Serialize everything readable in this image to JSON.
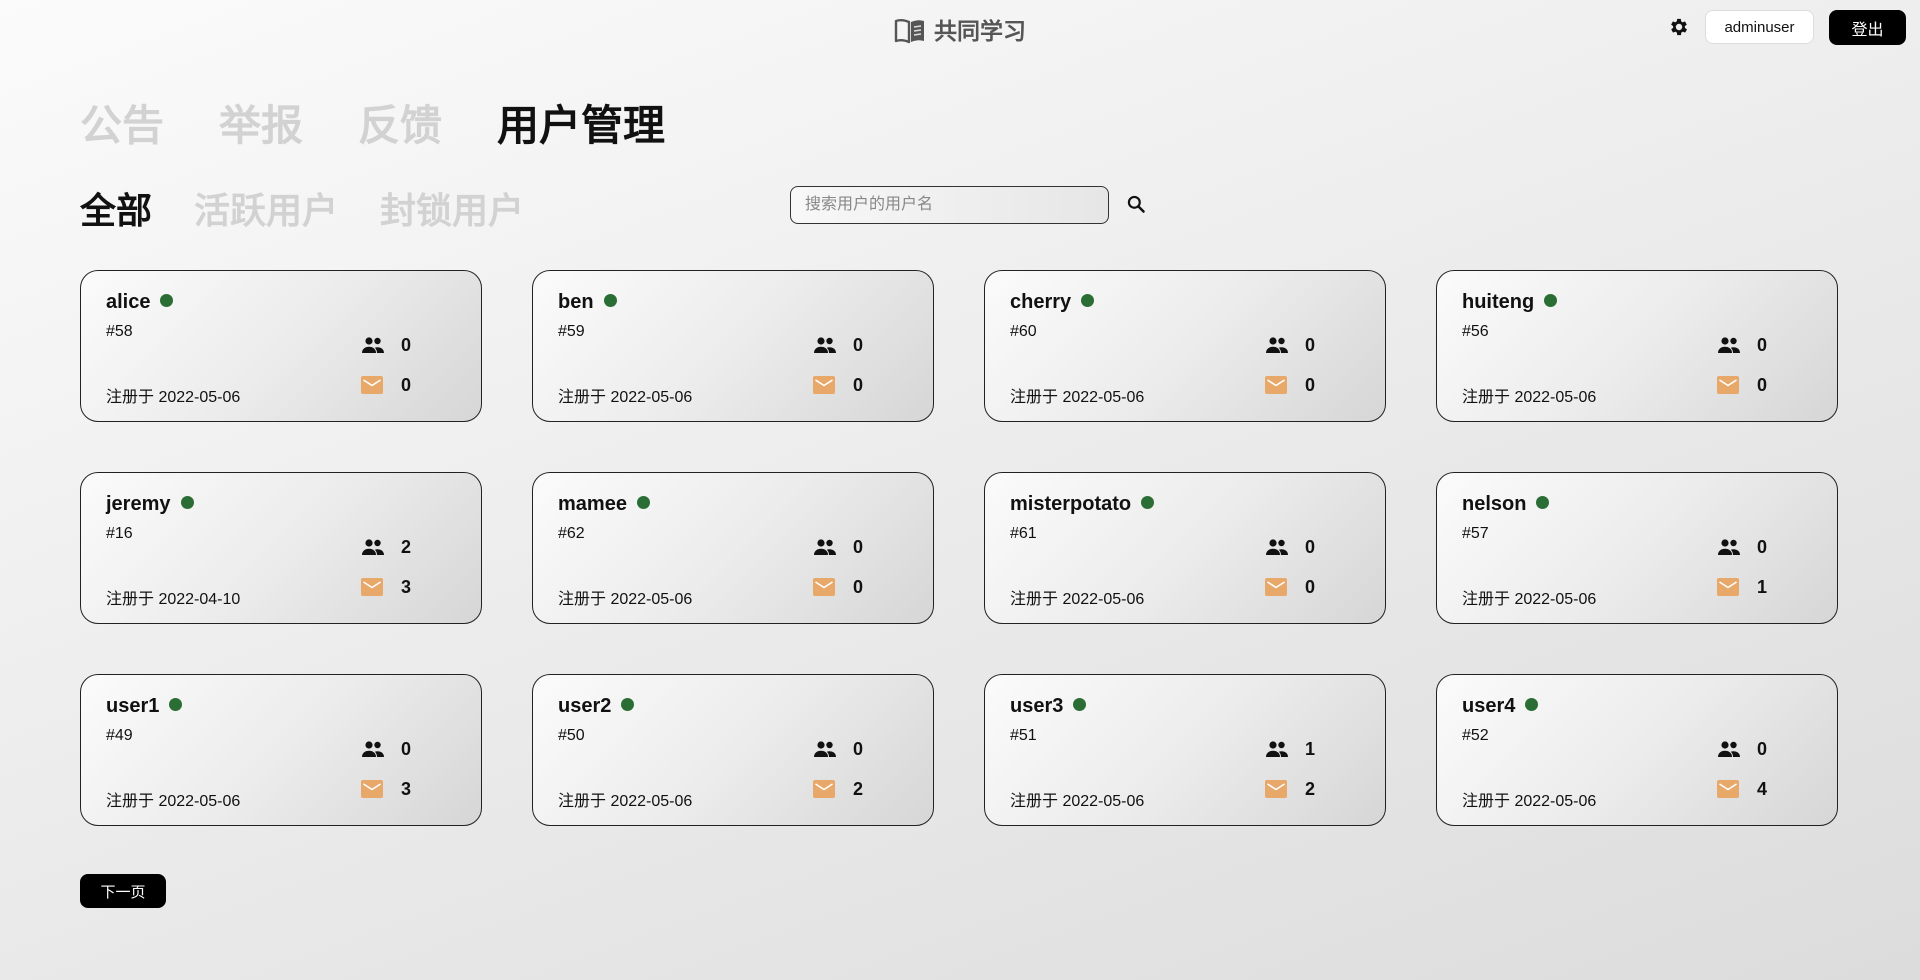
{
  "header": {
    "brand": "共同学习",
    "username": "adminuser",
    "logout_label": "登出"
  },
  "main_tabs": [
    {
      "label": "公告",
      "active": false
    },
    {
      "label": "举报",
      "active": false
    },
    {
      "label": "反馈",
      "active": false
    },
    {
      "label": "用户管理",
      "active": true
    }
  ],
  "sub_tabs": [
    {
      "label": "全部",
      "active": true
    },
    {
      "label": "活跃用户",
      "active": false
    },
    {
      "label": "封锁用户",
      "active": false
    }
  ],
  "search": {
    "placeholder": "搜索用户的用户名",
    "value": ""
  },
  "status_color": "#2b6e35",
  "mail_color": "#e8a86a",
  "users": [
    {
      "name": "alice",
      "id": "#58",
      "registered": "注册于 2022-05-06",
      "friends": "0",
      "messages": "0"
    },
    {
      "name": "ben",
      "id": "#59",
      "registered": "注册于 2022-05-06",
      "friends": "0",
      "messages": "0"
    },
    {
      "name": "cherry",
      "id": "#60",
      "registered": "注册于 2022-05-06",
      "friends": "0",
      "messages": "0"
    },
    {
      "name": "huiteng",
      "id": "#56",
      "registered": "注册于 2022-05-06",
      "friends": "0",
      "messages": "0"
    },
    {
      "name": "jeremy",
      "id": "#16",
      "registered": "注册于 2022-04-10",
      "friends": "2",
      "messages": "3"
    },
    {
      "name": "mamee",
      "id": "#62",
      "registered": "注册于 2022-05-06",
      "friends": "0",
      "messages": "0"
    },
    {
      "name": "misterpotato",
      "id": "#61",
      "registered": "注册于 2022-05-06",
      "friends": "0",
      "messages": "0"
    },
    {
      "name": "nelson",
      "id": "#57",
      "registered": "注册于 2022-05-06",
      "friends": "0",
      "messages": "1"
    },
    {
      "name": "user1",
      "id": "#49",
      "registered": "注册于 2022-05-06",
      "friends": "0",
      "messages": "3"
    },
    {
      "name": "user2",
      "id": "#50",
      "registered": "注册于 2022-05-06",
      "friends": "0",
      "messages": "2"
    },
    {
      "name": "user3",
      "id": "#51",
      "registered": "注册于 2022-05-06",
      "friends": "1",
      "messages": "2"
    },
    {
      "name": "user4",
      "id": "#52",
      "registered": "注册于 2022-05-06",
      "friends": "0",
      "messages": "4"
    }
  ],
  "pagination": {
    "next_label": "下一页"
  }
}
